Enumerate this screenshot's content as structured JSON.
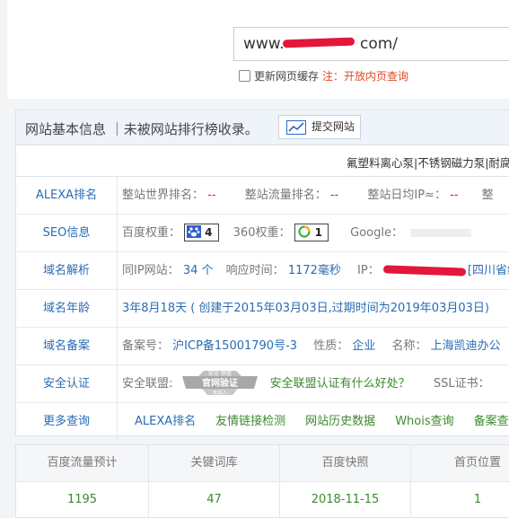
{
  "search": {
    "url_prefix": "www.",
    "url_suffix": "com/",
    "refresh_cache_label": "更新网页缓存",
    "note_prefix": "注：",
    "note_link": "开放内页查询"
  },
  "panel": {
    "title": "网站基本信息 ｜未被网站排行榜收录。",
    "submit_label": "提交网站",
    "ad_links": "氟塑料离心泵|不锈钢磁力泵|耐腐"
  },
  "rows": {
    "alexa": {
      "label": "ALEXA排名",
      "world_rank_key": "整站世界排名：",
      "world_rank_val": "--",
      "traffic_rank_key": "整站流量排名：",
      "traffic_rank_val": "--",
      "daily_ip_key": "整站日均IP≈：",
      "daily_ip_val": "--",
      "trailing": "整"
    },
    "seo": {
      "label": "SEO信息",
      "baidu_key": "百度权重：",
      "baidu_val": "4",
      "r360_key": "360权重：",
      "r360_val": "1",
      "google_key": "Google："
    },
    "domain": {
      "label": "域名解析",
      "same_ip_key": "同IP网站：",
      "same_ip_val": "34 个",
      "resp_key": "响应时间：",
      "resp_val": "1172毫秒",
      "ip_key": "IP：",
      "ip_location": "[四川省绵"
    },
    "age": {
      "label": "域名年龄",
      "value": "3年8月18天 ( 创建于2015年03月03日,过期时间为2019年03月03日)"
    },
    "icp": {
      "label": "域名备案",
      "number_key": "备案号：",
      "number_val": "沪ICP备15001790号-3",
      "nature_key": "性质：",
      "nature_val": "企业",
      "name_key": "名称：",
      "name_val": "上海凯迪办公"
    },
    "security": {
      "label": "安全认证",
      "union_key": "安全联盟:",
      "seal_top": "安全 联盟",
      "seal_main": "官网验证",
      "seal_bottom": "未加入",
      "link": "安全联盟认证有什么好处？",
      "ssl_key": "SSL证书："
    },
    "more": {
      "label": "更多查询",
      "links": [
        "ALEXA排名",
        "友情链接检测",
        "网站历史数据",
        "Whois查询",
        "备案查"
      ]
    }
  },
  "stats": {
    "headers": [
      "百度流量预计",
      "关键词库",
      "百度快照",
      "首页位置"
    ],
    "values": [
      "1195",
      "47",
      "2018-11-15",
      "1"
    ]
  },
  "colors": {
    "accent_blue": "#2a6bb5",
    "accent_red": "#e1202f",
    "accent_green": "#3b8a2e",
    "note_orange": "#e14b23"
  }
}
